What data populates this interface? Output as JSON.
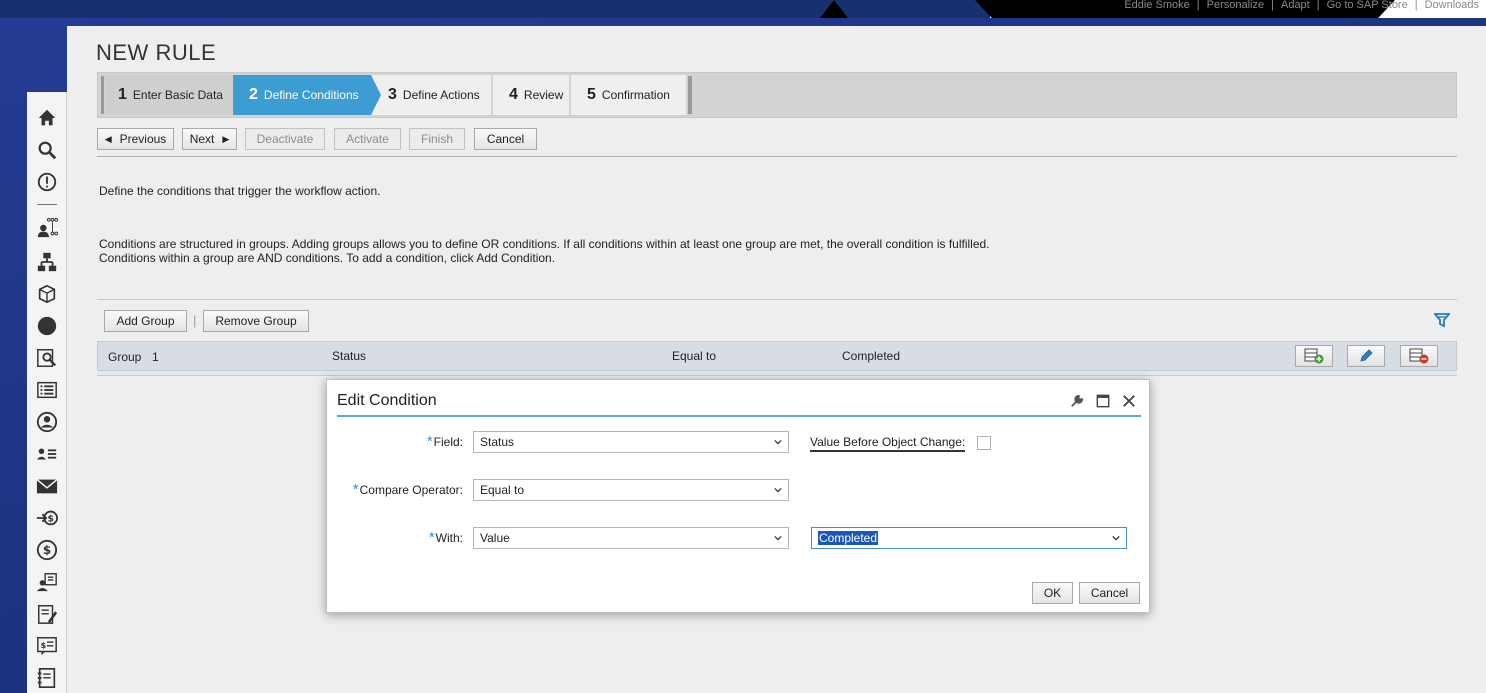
{
  "topbar": {
    "links": [
      "Eddie Smoke",
      "Personalize",
      "Adapt",
      "Go to SAP Store",
      "Downloads"
    ]
  },
  "nav": {
    "icons": [
      "home-icon",
      "search-icon",
      "alert-icon",
      "org-people-icon",
      "hierarchy-icon",
      "package-icon",
      "circle-icon",
      "inspect-icon",
      "list-icon",
      "user-circle-icon",
      "people-list-icon",
      "mail-icon",
      "money-in-icon",
      "dollar-icon",
      "person-card-icon",
      "sign-doc-icon",
      "price-list-icon",
      "notebook-icon"
    ]
  },
  "page": {
    "title": "NEW RULE"
  },
  "wizard": {
    "steps": [
      {
        "num": "1",
        "label": "Enter Basic Data",
        "state": "done"
      },
      {
        "num": "2",
        "label": "Define Conditions",
        "state": "current"
      },
      {
        "num": "3",
        "label": "Define Actions",
        "state": "pending"
      },
      {
        "num": "4",
        "label": "Review",
        "state": "pending"
      },
      {
        "num": "5",
        "label": "Confirmation",
        "state": "pending"
      }
    ]
  },
  "toolbar": {
    "previous": "Previous",
    "next": "Next",
    "deactivate": "Deactivate",
    "activate": "Activate",
    "finish": "Finish",
    "cancel": "Cancel"
  },
  "content": {
    "intro": "Define the conditions that trigger the workflow action.",
    "help_line1": "Conditions are structured in groups. Adding groups allows you to define OR conditions. If all conditions within at least one group are met, the overall condition is fulfilled.",
    "help_line2": "Conditions within a group are AND conditions. To add a condition, click Add Condition."
  },
  "groups": {
    "add_group": "Add Group",
    "remove_group": "Remove Group",
    "separator": "|",
    "row": {
      "group_label": "Group",
      "group_num": "1",
      "field": "Status",
      "operator": "Equal to",
      "value": "Completed"
    }
  },
  "dialog": {
    "title": "Edit Condition",
    "field_label": "Field:",
    "field_value": "Status",
    "value_before_label": "Value Before Object Change:",
    "value_before_checked": false,
    "operator_label": "Compare Operator:",
    "operator_value": "Equal to",
    "with_label": "With:",
    "with_value": "Value",
    "with_target": "Completed",
    "required_mark": "*",
    "ok": "OK",
    "cancel": "Cancel"
  },
  "colors": {
    "accent": "#3d9cd2",
    "navy": "#1c3384",
    "required": "#3b8dd0"
  }
}
